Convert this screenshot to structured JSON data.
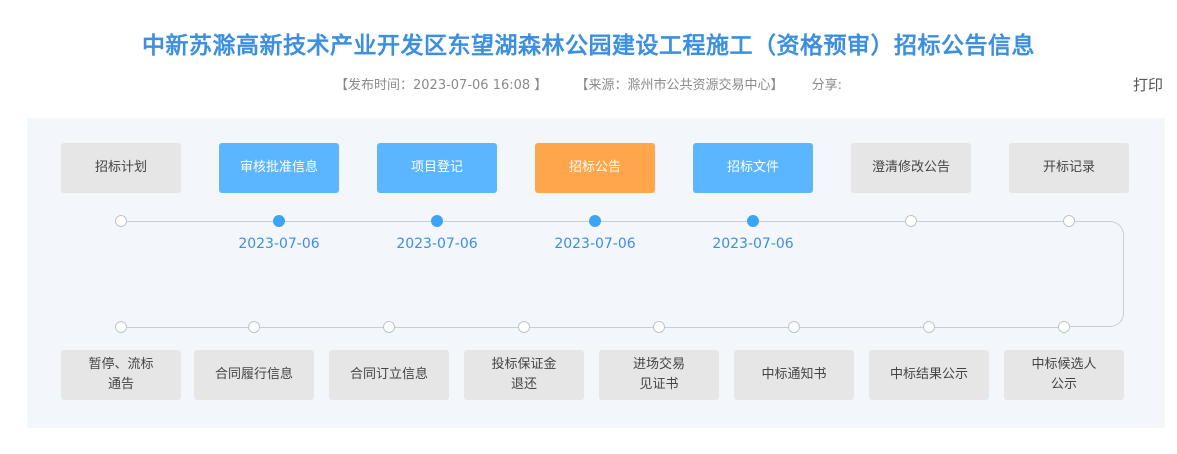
{
  "header": {
    "title": "中新苏滁高新技术产业开发区东望湖森林公园建设工程施工（资格预审）招标公告信息",
    "publish_time": "【发布时间：2023-07-06 16:08 】",
    "source": "【来源：滁州市公共资源交易中心】",
    "share_label": "分享:",
    "print_label": "打印"
  },
  "steps_top": [
    {
      "label": "招标计划",
      "state": "inactive",
      "date": ""
    },
    {
      "label": "审核批准信息",
      "state": "done",
      "date": "2023-07-06"
    },
    {
      "label": "项目登记",
      "state": "done",
      "date": "2023-07-06"
    },
    {
      "label": "招标公告",
      "state": "current",
      "date": "2023-07-06"
    },
    {
      "label": "招标文件",
      "state": "done",
      "date": "2023-07-06"
    },
    {
      "label": "澄清修改公告",
      "state": "inactive",
      "date": ""
    },
    {
      "label": "开标记录",
      "state": "inactive",
      "date": ""
    }
  ],
  "steps_bottom": [
    {
      "label": "暂停、流标\n通告",
      "state": "inactive"
    },
    {
      "label": "合同履行信息",
      "state": "inactive"
    },
    {
      "label": "合同订立信息",
      "state": "inactive"
    },
    {
      "label": "投标保证金\n退还",
      "state": "inactive"
    },
    {
      "label": "进场交易\n见证书",
      "state": "inactive"
    },
    {
      "label": "中标通知书",
      "state": "inactive"
    },
    {
      "label": "中标结果公示",
      "state": "inactive"
    },
    {
      "label": "中标候选人\n公示",
      "state": "inactive"
    }
  ],
  "colors": {
    "title": "#3d8fe0",
    "done": "#5bb6ff",
    "current": "#ffa64d",
    "inactive": "#e6e6e6",
    "panel": "#f3f7fc"
  }
}
